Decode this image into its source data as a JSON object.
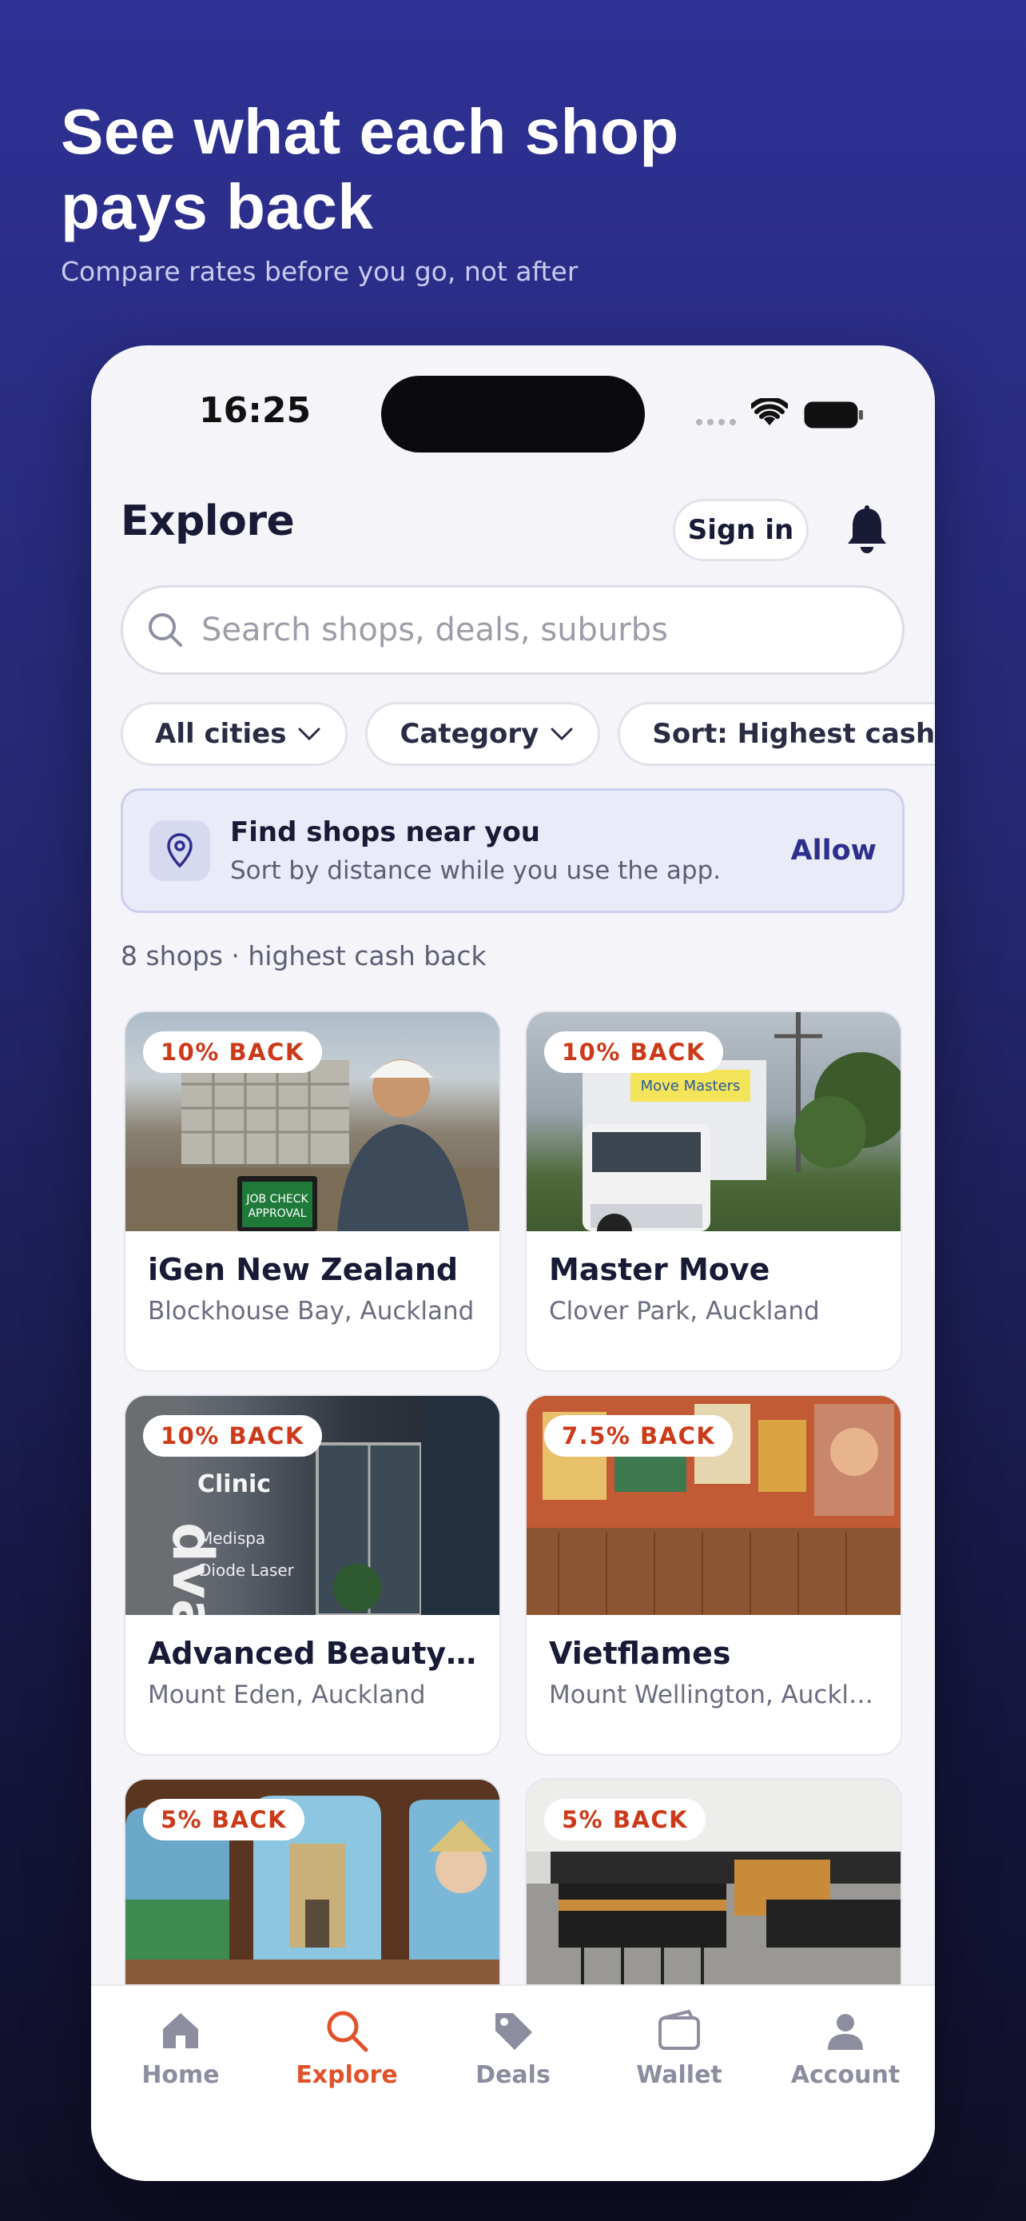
{
  "promo": {
    "title_line1": "See what each shop",
    "title_line2": "pays back",
    "subtitle": "Compare rates before you go, not after"
  },
  "status_bar": {
    "time": "16:25"
  },
  "header": {
    "title": "Explore",
    "sign_in": "Sign in"
  },
  "search": {
    "placeholder": "Search shops, deals, suburbs",
    "value": ""
  },
  "filters": {
    "cities": "All cities",
    "category": "Category",
    "sort": "Sort: Highest cash back"
  },
  "location_prompt": {
    "title": "Find shops near you",
    "subtitle": "Sort by distance while you use the app.",
    "action": "Allow"
  },
  "results_summary": "8 shops · highest cash back",
  "shops": [
    {
      "badge": "10% BACK",
      "name": "iGen New Zealand",
      "location": "Blockhouse Bay, Auckland"
    },
    {
      "badge": "10% BACK",
      "name": "Master Move",
      "location": "Clover Park, Auckland"
    },
    {
      "badge": "10% BACK",
      "name": "Advanced Beauty Cli...",
      "location": "Mount Eden, Auckland"
    },
    {
      "badge": "7.5% BACK",
      "name": "Vietflames",
      "location": "Mount Wellington, Auckla..."
    },
    {
      "badge": "5% BACK",
      "name": "",
      "location": ""
    },
    {
      "badge": "5% BACK",
      "name": "",
      "location": ""
    }
  ],
  "tabs": [
    {
      "label": "Home",
      "icon": "home-icon",
      "active": false
    },
    {
      "label": "Explore",
      "icon": "search-icon",
      "active": true
    },
    {
      "label": "Deals",
      "icon": "tag-icon",
      "active": false
    },
    {
      "label": "Wallet",
      "icon": "wallet-icon",
      "active": false
    },
    {
      "label": "Account",
      "icon": "person-icon",
      "active": false
    }
  ],
  "colors": {
    "accent": "#e0522b",
    "badge_text": "#cc3a1a",
    "primary": "#2d2f8c",
    "ink": "#181a36",
    "background_top": "#2e3194"
  }
}
